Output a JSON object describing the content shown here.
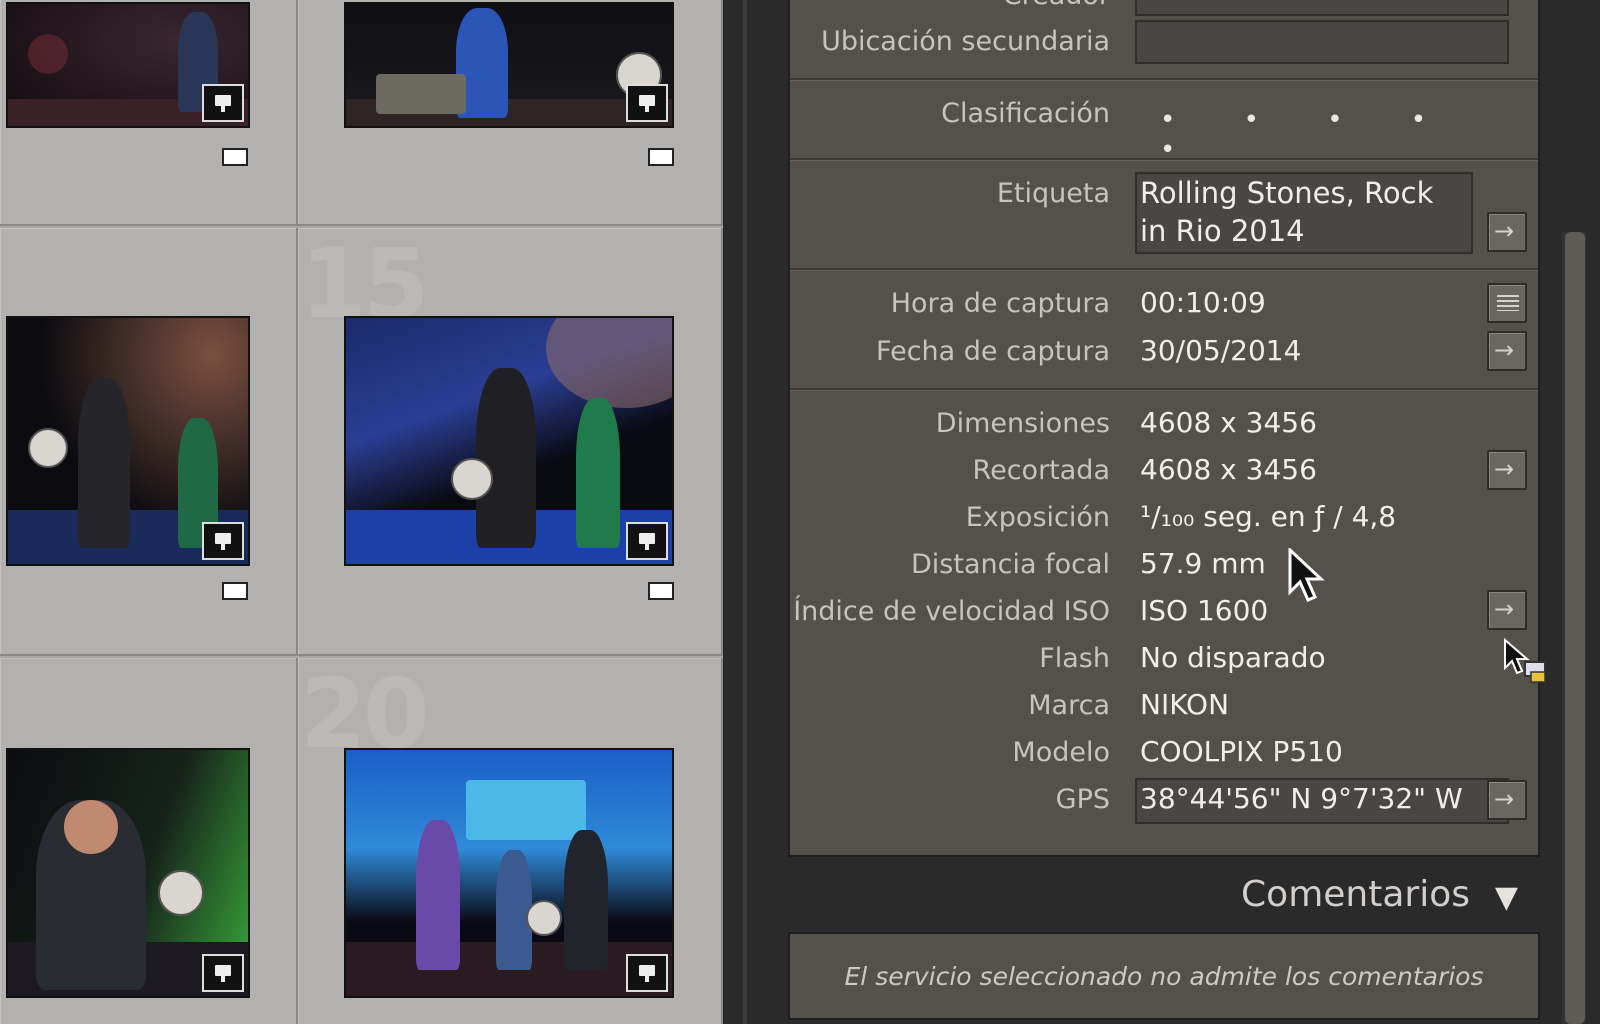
{
  "grid": {
    "cell_numbers": [
      "15",
      "20"
    ]
  },
  "metadata": {
    "cut_top_label": "Creador",
    "secondary_location_label": "Ubicación secundaria",
    "rating_label": "Clasificación",
    "rating_dots": "• • • • •",
    "tag_label": "Etiqueta",
    "tag_value_line1": "Rolling Stones, Rock",
    "tag_value_line2": "in Rio 2014",
    "capture_time_label": "Hora de captura",
    "capture_time": "00:10:09",
    "capture_date_label": "Fecha de captura",
    "capture_date": "30/05/2014",
    "dimensions_label": "Dimensiones",
    "dimensions": "4608 x 3456",
    "cropped_label": "Recortada",
    "cropped": "4608 x 3456",
    "exposure_label": "Exposición",
    "exposure": "¹/₁₀₀ seg. en ƒ / 4,8",
    "focal_label": "Distancia focal",
    "focal": "57.9 mm",
    "iso_label": "Índice de velocidad ISO",
    "iso": "ISO 1600",
    "flash_label": "Flash",
    "flash": "No disparado",
    "make_label": "Marca",
    "make": "NIKON",
    "model_label": "Modelo",
    "model": "COOLPIX P510",
    "gps_label": "GPS",
    "gps": "38°44'56\" N 9°7'32\" W"
  },
  "comments": {
    "title": "Comentarios",
    "message": "El servicio seleccionado no admite los comentarios"
  },
  "icons": [
    "badge-icon",
    "arrow-icon",
    "list-icon",
    "triangle-down-icon",
    "cursor-icon"
  ]
}
